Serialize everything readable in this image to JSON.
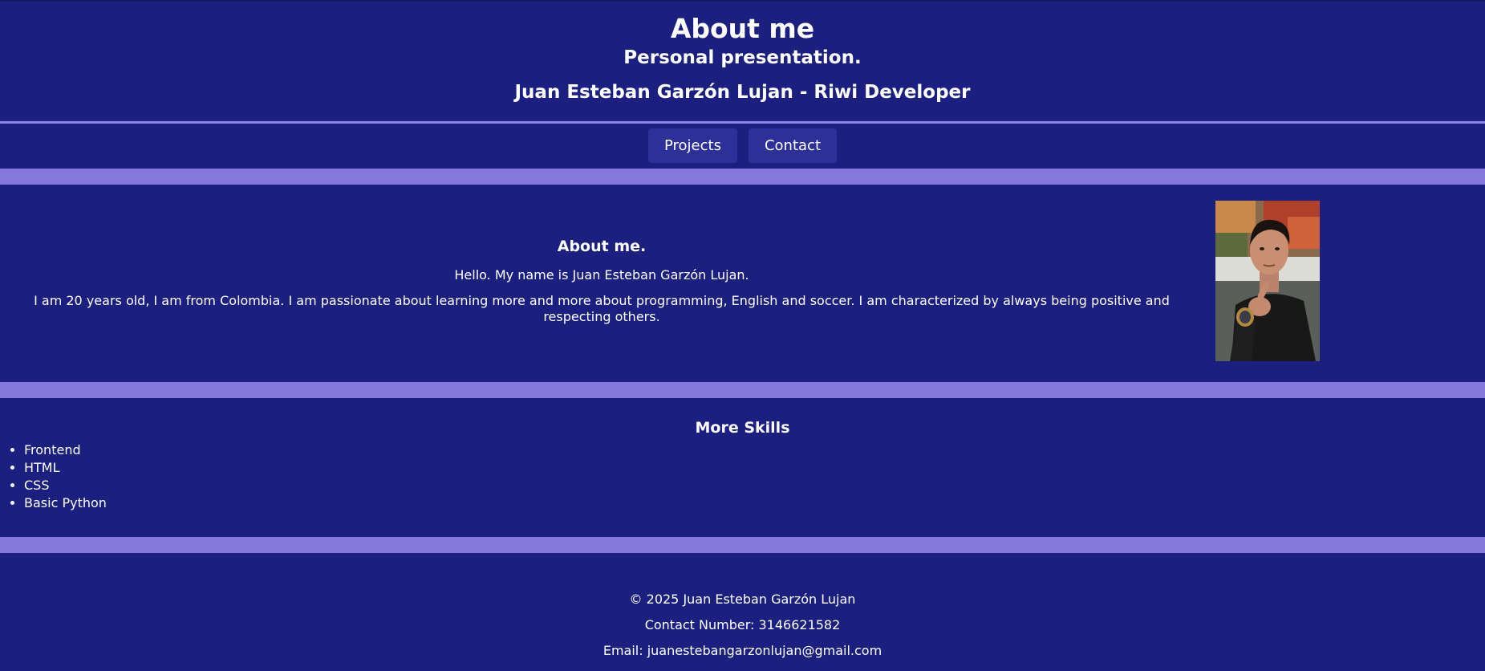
{
  "header": {
    "title": "About me",
    "subtitle": "Personal presentation.",
    "name_line": "Juan Esteban Garzón Lujan - Riwi Developer"
  },
  "nav": {
    "items": [
      {
        "label": "Projects"
      },
      {
        "label": "Contact"
      }
    ]
  },
  "about": {
    "heading": "About me.",
    "intro": "Hello. My name is Juan Esteban Garzón Lujan.",
    "description": "I am 20 years old, I am from Colombia. I am passionate about learning more and more about programming, English and soccer. I am characterized by always being positive and respecting others."
  },
  "skills": {
    "heading": "More Skills",
    "items": [
      "Frontend",
      "HTML",
      "CSS",
      "Basic Python"
    ]
  },
  "footer": {
    "copyright": "© 2025 Juan Esteban Garzón Lujan",
    "contact_number": "Contact Number: 3146621582",
    "email": "Email: juanestebangarzonlujan@gmail.com"
  },
  "colors": {
    "background": "#1b2080",
    "band": "#8778de",
    "nav_button": "#2c3098",
    "text": "#ffffff"
  }
}
